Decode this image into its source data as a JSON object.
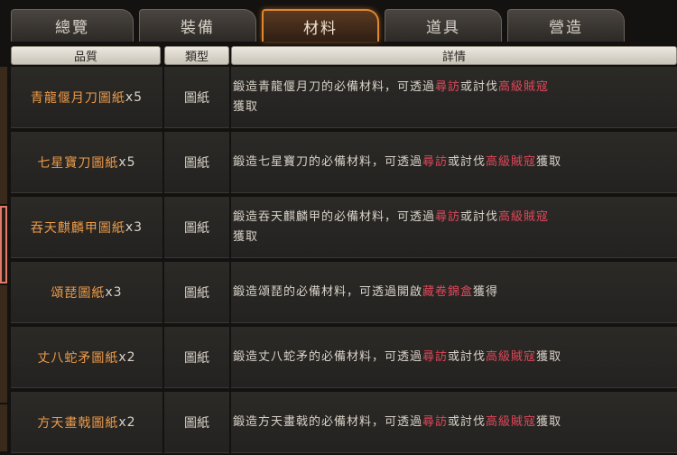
{
  "tabs": [
    {
      "label": "總覽"
    },
    {
      "label": "裝備"
    },
    {
      "label": "材料"
    },
    {
      "label": "道具"
    },
    {
      "label": "營造"
    }
  ],
  "table": {
    "headers": {
      "quality": "品質",
      "type": "類型",
      "detail": "詳情"
    },
    "rows": [
      {
        "name": "青龍偃月刀圖紙",
        "qty": "x5",
        "type": "圖紙",
        "d1": "鍛造青龍偃月刀的必備材料，可透過",
        "h1": "尋訪",
        "d2": "或討伐",
        "h2": "高級賊寇",
        "d3": "獲取"
      },
      {
        "name": "七星寶刀圖紙",
        "qty": "x5",
        "type": "圖紙",
        "d1": "鍛造七星寶刀的必備材料，可透過",
        "h1": "尋訪",
        "d2": "或討伐",
        "h2": "高級賊寇",
        "d3": "獲取"
      },
      {
        "name": "吞天麒麟甲圖紙",
        "qty": "x3",
        "type": "圖紙",
        "d1": "鍛造吞天麒麟甲的必備材料，可透過",
        "h1": "尋訪",
        "d2": "或討伐",
        "h2": "高級賊寇",
        "d3": "獲取"
      },
      {
        "name": "頌琵圖紙",
        "qty": "x3",
        "type": "圖紙",
        "d1": "鍛造頌琵的必備材料，可透過開啟",
        "h1": "藏卷錦盒",
        "d2": "獲得",
        "h2": "",
        "d3": ""
      },
      {
        "name": "丈八蛇矛圖紙",
        "qty": "x2",
        "type": "圖紙",
        "d1": "鍛造丈八蛇矛的必備材料，可透過",
        "h1": "尋訪",
        "d2": "或討伐",
        "h2": "高級賊寇",
        "d3": "獲取"
      },
      {
        "name": "方天畫戟圖紙",
        "qty": "x2",
        "type": "圖紙",
        "d1": "鍛造方天畫戟的必備材料，可透過",
        "h1": "尋訪",
        "d2": "或討伐",
        "h2": "高級賊寇",
        "d3": "獲取"
      }
    ]
  },
  "colors": {
    "accent": "#e0872e",
    "item_name": "#ea9a4a",
    "highlight": "#e0485a"
  }
}
